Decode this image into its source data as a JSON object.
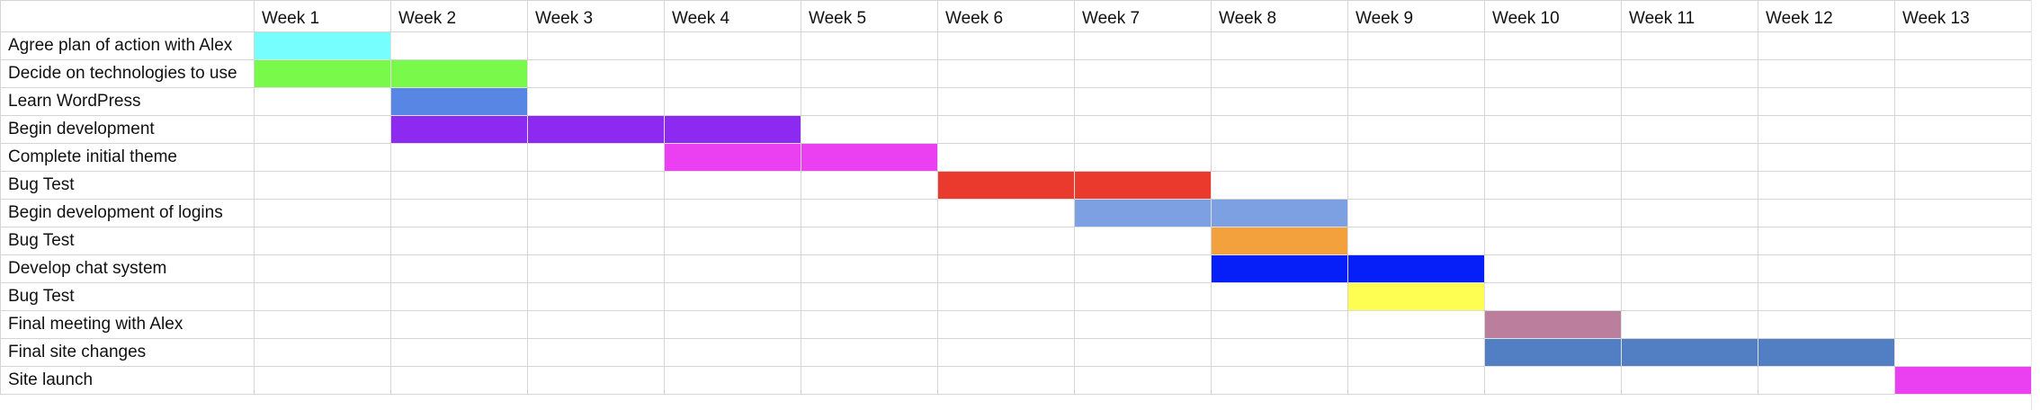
{
  "weeks": [
    "Week 1",
    "Week 2",
    "Week 3",
    "Week 4",
    "Week 5",
    "Week 6",
    "Week 7",
    "Week 8",
    "Week 9",
    "Week 10",
    "Week 11",
    "Week 12",
    "Week 13"
  ],
  "tasks": [
    {
      "label": "Agree plan of action with Alex",
      "start": 1,
      "end": 1,
      "color": "#76fdfd"
    },
    {
      "label": "Decide on technologies to use",
      "start": 1,
      "end": 2,
      "color": "#79fa4a"
    },
    {
      "label": "Learn WordPress",
      "start": 2,
      "end": 2,
      "color": "#5786e4"
    },
    {
      "label": "Begin development",
      "start": 2,
      "end": 4,
      "color": "#8d2af2"
    },
    {
      "label": "Complete initial theme",
      "start": 4,
      "end": 5,
      "color": "#ea40f2"
    },
    {
      "label": "Bug Test",
      "start": 6,
      "end": 7,
      "color": "#e93a2d"
    },
    {
      "label": "Begin development of logins",
      "start": 7,
      "end": 8,
      "color": "#7da0e2"
    },
    {
      "label": "Bug Test",
      "start": 8,
      "end": 8,
      "color": "#f3a13d"
    },
    {
      "label": "Develop chat system",
      "start": 8,
      "end": 9,
      "color": "#061ff8"
    },
    {
      "label": "Bug Test",
      "start": 9,
      "end": 9,
      "color": "#fdfd52"
    },
    {
      "label": "Final meeting with Alex",
      "start": 10,
      "end": 10,
      "color": "#bb7f9d"
    },
    {
      "label": "Final site changes",
      "start": 10,
      "end": 12,
      "color": "#527fc3"
    },
    {
      "label": "Site launch",
      "start": 13,
      "end": 13,
      "color": "#ea40f2"
    }
  ]
}
